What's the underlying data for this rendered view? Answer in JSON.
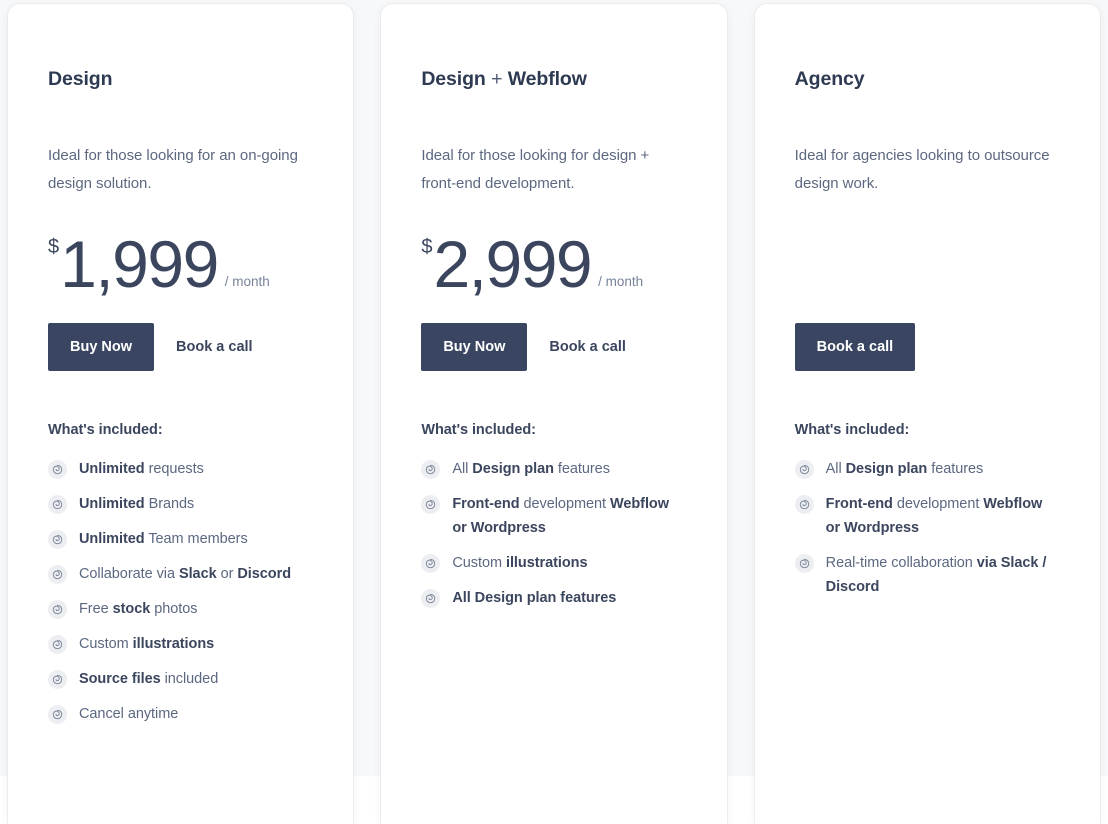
{
  "page": {
    "background_color": "#f7f8f9",
    "card_background": "#ffffff",
    "accent_color": "#3a4661",
    "heading_color": "#2e3a52",
    "body_text_color": "#5c6880",
    "bullet_icon_name": "spiral-icon",
    "bullet_icon_bg": "#eceef1"
  },
  "plans": [
    {
      "name": "Design",
      "name_prefix": "Design",
      "name_plus": "",
      "name_suffix": "",
      "description": "Ideal for those looking for an on-going design solution.",
      "has_price": true,
      "currency": "$",
      "amount": "1,999",
      "period": "/ month",
      "primary_button": "Buy Now",
      "secondary_button": "Book a call",
      "has_primary_button": true,
      "has_secondary_button": true,
      "included_label": "What's included:",
      "features": [
        [
          {
            "t": "Unlimited",
            "b": true
          },
          {
            "t": " requests",
            "b": false
          }
        ],
        [
          {
            "t": "Unlimited",
            "b": true
          },
          {
            "t": " Brands",
            "b": false
          }
        ],
        [
          {
            "t": "Unlimited",
            "b": true
          },
          {
            "t": " Team members",
            "b": false
          }
        ],
        [
          {
            "t": "Collaborate via ",
            "b": false
          },
          {
            "t": "Slack",
            "b": true
          },
          {
            "t": " or ",
            "b": false
          },
          {
            "t": "Discord",
            "b": true
          }
        ],
        [
          {
            "t": "Free ",
            "b": false
          },
          {
            "t": "stock",
            "b": true
          },
          {
            "t": " photos",
            "b": false
          }
        ],
        [
          {
            "t": "Custom ",
            "b": false
          },
          {
            "t": "illustrations",
            "b": true
          }
        ],
        [
          {
            "t": "Source files",
            "b": true
          },
          {
            "t": " included",
            "b": false
          }
        ],
        [
          {
            "t": "Cancel anytime",
            "b": false
          }
        ]
      ]
    },
    {
      "name": "Design + Webflow",
      "name_prefix": "Design",
      "name_plus": " + ",
      "name_suffix": "Webflow",
      "description": "Ideal for those looking for design + front-end development.",
      "has_price": true,
      "currency": "$",
      "amount": "2,999",
      "period": "/ month",
      "primary_button": "Buy Now",
      "secondary_button": "Book a call",
      "has_primary_button": true,
      "has_secondary_button": true,
      "included_label": "What's included:",
      "features": [
        [
          {
            "t": "All ",
            "b": false
          },
          {
            "t": "Design plan",
            "b": true
          },
          {
            "t": " features",
            "b": false
          }
        ],
        [
          {
            "t": "Front-end",
            "b": true
          },
          {
            "t": " development ",
            "b": false
          },
          {
            "t": "Webflow or Wordpress",
            "b": true
          }
        ],
        [
          {
            "t": "Custom ",
            "b": false
          },
          {
            "t": "illustrations",
            "b": true
          }
        ],
        [
          {
            "t": "All Design plan features",
            "b": true
          }
        ]
      ]
    },
    {
      "name": "Agency",
      "name_prefix": "Agency",
      "name_plus": "",
      "name_suffix": "",
      "description": "Ideal for agencies looking to outsource design work.",
      "has_price": false,
      "currency": "",
      "amount": "",
      "period": "",
      "primary_button": "Book a call",
      "secondary_button": "",
      "has_primary_button": true,
      "has_secondary_button": false,
      "included_label": "What's included:",
      "features": [
        [
          {
            "t": "All ",
            "b": false
          },
          {
            "t": "Design plan",
            "b": true
          },
          {
            "t": " features",
            "b": false
          }
        ],
        [
          {
            "t": "Front-end",
            "b": true
          },
          {
            "t": " development ",
            "b": false
          },
          {
            "t": "Webflow or Wordpress",
            "b": true
          }
        ],
        [
          {
            "t": "Real-time collaboration ",
            "b": false
          },
          {
            "t": "via Slack / Discord",
            "b": true
          }
        ]
      ]
    }
  ]
}
